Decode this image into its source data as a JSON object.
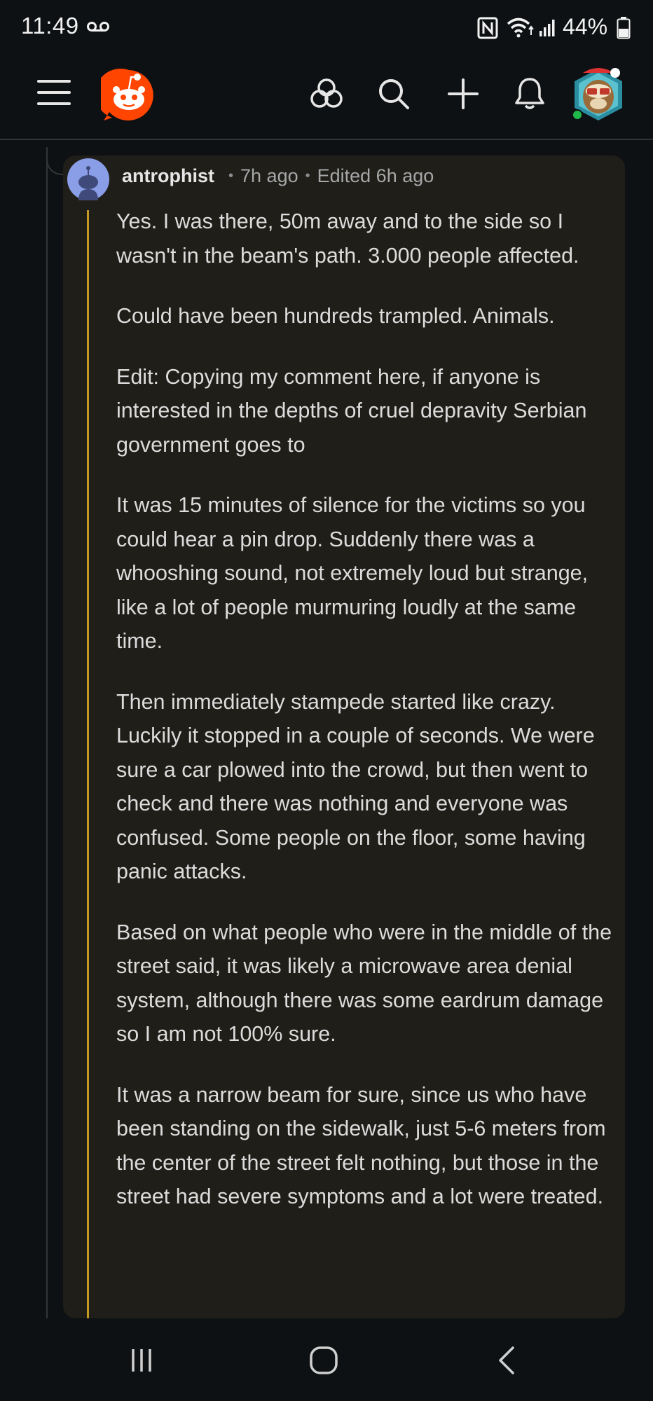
{
  "status_bar": {
    "time": "11:49",
    "battery": "44%",
    "icons": [
      "voicemail-icon",
      "nfc-icon",
      "wifi-icon",
      "signal-icon",
      "battery-icon"
    ]
  },
  "header": {
    "icons": [
      "menu-icon",
      "reddit-logo-icon",
      "chat-icon",
      "search-icon",
      "plus-icon",
      "bell-icon",
      "user-avatar"
    ]
  },
  "comment": {
    "author": "antrophist",
    "separator": "•",
    "time_ago": "7h ago",
    "edited": "Edited 6h ago",
    "paragraphs": [
      "Yes. I was there, 50m away and to the side so I wasn't in the beam's path. 3.000 people affected.",
      "Could have been hundreds trampled. Animals.",
      "Edit: Copying my comment here, if anyone is interested in the depths of cruel depravity Serbian government goes to",
      "It was 15 minutes of silence for the victims so you could hear a pin drop. Suddenly there was a whooshing sound, not extremely loud but strange, like a lot of people murmuring loudly at the same time.",
      "Then immediately stampede started like crazy. Luckily it stopped in a couple of seconds. We were sure a car plowed into the crowd, but then went to check and there was nothing and everyone was confused. Some people on the floor, some having panic attacks.",
      "Based on what people who were in the middle of the street said, it was likely a microwave area denial system, although there was some eardrum damage so I am not 100% sure.",
      "It was a narrow beam for sure, since us who have been standing on the sidewalk, just 5-6 meters from the center of the street felt nothing, but those in the street had severe symptoms and a lot were treated."
    ]
  },
  "nav_bar": {
    "icons": [
      "recents-icon",
      "home-icon",
      "back-icon"
    ]
  },
  "colors": {
    "background": "#0e1113",
    "card": "#201e18",
    "thread_accent": "#c69a22",
    "reddit_orange": "#ff4500"
  }
}
